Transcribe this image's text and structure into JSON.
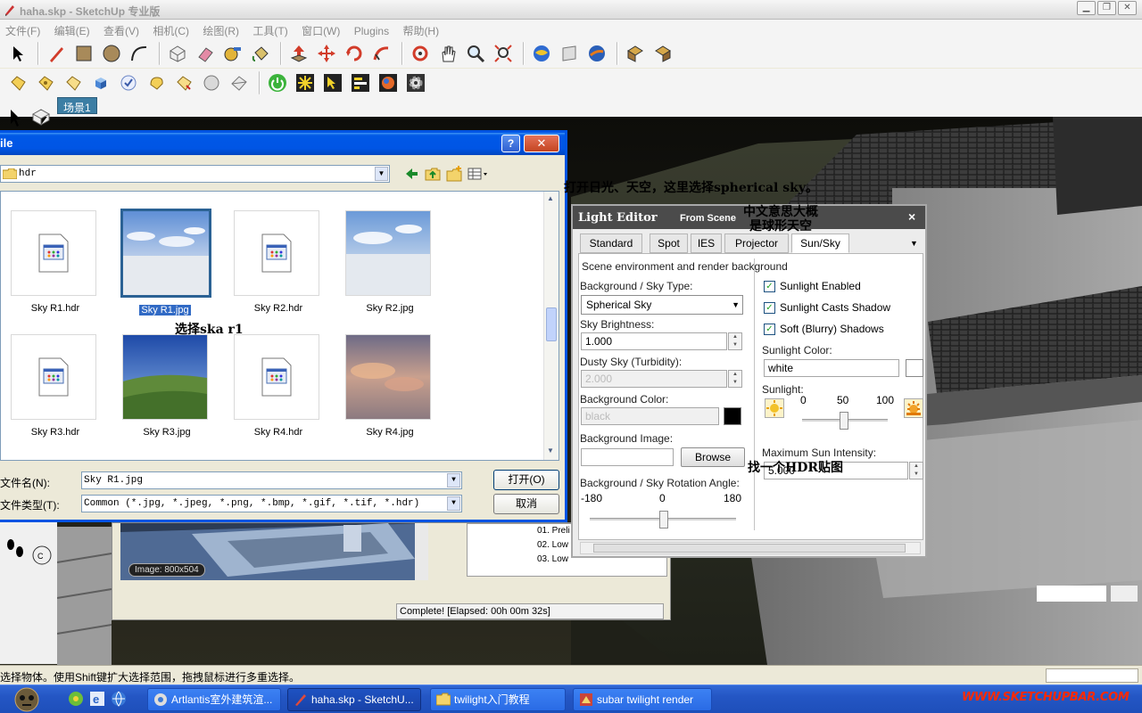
{
  "window": {
    "title": "haha.skp - SketchUp 专业版"
  },
  "menubar": [
    "文件(F)",
    "编辑(E)",
    "查看(V)",
    "相机(C)",
    "绘图(R)",
    "工具(T)",
    "窗口(W)",
    "Plugins",
    "帮助(H)"
  ],
  "scene": {
    "tab_label": "场景1"
  },
  "file_dialog": {
    "title": "ile",
    "look_in": "hdr",
    "files": [
      {
        "name": "Sky R1.hdr",
        "kind": "hdr",
        "selected": false
      },
      {
        "name": "Sky R1.jpg",
        "kind": "sky",
        "selected": true
      },
      {
        "name": "Sky R2.hdr",
        "kind": "hdr",
        "selected": false
      },
      {
        "name": "Sky R2.jpg",
        "kind": "sky",
        "selected": false
      },
      {
        "name": "Sky R3.hdr",
        "kind": "hdr",
        "selected": false
      },
      {
        "name": "Sky R3.jpg",
        "kind": "landscape",
        "selected": false
      },
      {
        "name": "Sky R4.hdr",
        "kind": "hdr",
        "selected": false
      },
      {
        "name": "Sky R4.jpg",
        "kind": "sunset",
        "selected": false
      }
    ],
    "filename_label": "文件名(N):",
    "filename_value": "Sky R1.jpg",
    "filetype_label": "文件类型(T):",
    "filetype_value": "Common (*.jpg, *.jpeg, *.png, *.bmp, *.gif, *.tif, *.hdr)",
    "open_button": "打开(O)",
    "cancel_button": "取消"
  },
  "annotations": {
    "select_note": "选择ska r1",
    "sun_sky_note": "打开日光、天空，这里选择spherical sky。",
    "meaning_note_1": "中文意思大概",
    "meaning_note_2": "是球形天空",
    "hdr_note": "找一个HDR贴图"
  },
  "light_editor": {
    "title": "Light Editor",
    "from_scene": "From Scene",
    "close": "×",
    "tabs": [
      "Standard",
      "Spot",
      "IES",
      "Projector",
      "Sun/Sky"
    ],
    "active_tab": "Sun/Sky",
    "heading": "Scene environment and render background",
    "bg_type_label": "Background / Sky Type:",
    "bg_type_value": "Spherical Sky",
    "sky_brightness_label": "Sky Brightness:",
    "sky_brightness_value": "1.000",
    "dusty_sky_label": "Dusty Sky (Turbidity):",
    "dusty_sky_value": "2.000",
    "bg_color_label": "Background Color:",
    "bg_color_value": "black",
    "bg_image_label": "Background Image:",
    "browse_button": "Browse",
    "rotation_label": "Background / Sky Rotation Angle:",
    "rotation_min": "-180",
    "rotation_mid": "0",
    "rotation_max": "180",
    "sunlight_enabled": "Sunlight Enabled",
    "sunlight_casts_shadow": "Sunlight Casts Shadow",
    "soft_shadows": "Soft (Blurry) Shadows",
    "sunlight_color_label": "Sunlight Color:",
    "sunlight_color_value": "white",
    "sunlight_label": "Sunlight:",
    "sunlight_min": "0",
    "sunlight_mid": "50",
    "sunlight_max": "100",
    "max_sun_label": "Maximum Sun Intensity:",
    "max_sun_value": "5.000"
  },
  "preview": {
    "image_size": "Image: 800x504",
    "list_items": [
      "01. Preli",
      "02. Low",
      "03. Low"
    ],
    "status": "Complete! [Elapsed: 00h 00m 32s]"
  },
  "statusbar": {
    "text": "选择物体。使用Shift键扩大选择范围，拖拽鼠标进行多重选择。"
  },
  "taskbar": {
    "tasks": [
      "Artlantis室外建筑渲...",
      "haha.skp - SketchU...",
      "twilight入门教程",
      "subar twilight  render"
    ],
    "tray_logo": "WWW.SKETCHUPBAR.COM"
  }
}
